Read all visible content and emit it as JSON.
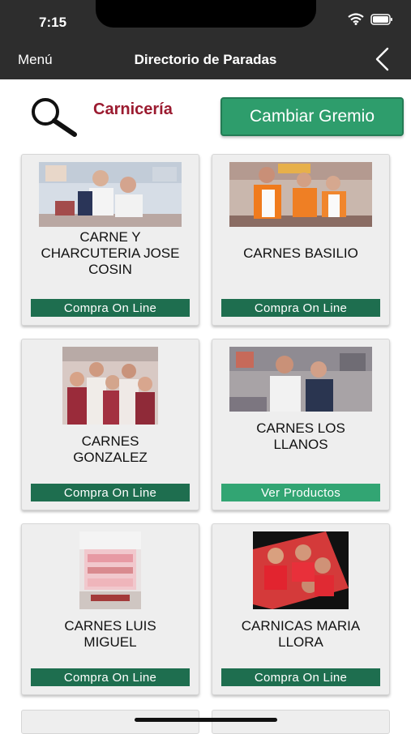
{
  "status": {
    "time": "7:15"
  },
  "nav": {
    "menu_label": "Menú",
    "title": "Directorio de Paradas"
  },
  "filter": {
    "guild": "Carnicería",
    "change_label": "Cambiar Gremio"
  },
  "stalls": [
    {
      "name": "CARNE Y CHARCUTERIA JOSE COSIN",
      "action": "Compra On Line"
    },
    {
      "name": "CARNES BASILIO",
      "action": "Compra On Line"
    },
    {
      "name": "CARNES GONZALEZ",
      "action": "Compra On Line"
    },
    {
      "name": "CARNES LOS LLANOS",
      "action": "Ver Productos"
    },
    {
      "name": "CARNES LUIS MIGUEL",
      "action": "Compra On Line"
    },
    {
      "name": "CARNICAS MARIA LLORA",
      "action": "Compra On Line"
    }
  ],
  "colors": {
    "bar": "#2d2d2d",
    "accent_green": "#2e9d6c",
    "dark_green": "#1e6e4f",
    "guild_red": "#9b1b30"
  }
}
